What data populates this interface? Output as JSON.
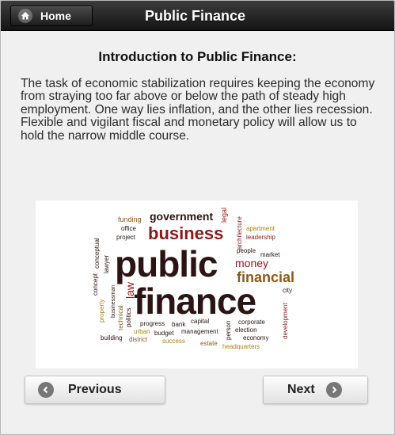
{
  "header": {
    "home_label": "Home",
    "title": "Public Finance"
  },
  "intro": {
    "heading": "Introduction to Public Finance:",
    "text": "The task of economic stabilization requires keeping the economy from straying too far above or below the path of steady high employment. One way lies inflation, and the other lies recession. Flexible and vigilant fiscal and monetary policy will allow us to hold the narrow middle course."
  },
  "word_cloud": {
    "words": {
      "funding": "funding",
      "office": "office",
      "project": "project",
      "government": "government",
      "legal": "legal",
      "architecture": "architecture",
      "apartment": "apartment",
      "leadership": "leadership",
      "business": "business",
      "conceptual": "conceptual",
      "concept": "concept",
      "lawyer": "lawyer",
      "businessman": "businessman",
      "public": "public",
      "people": "people",
      "market": "market",
      "money": "money",
      "financial": "financial",
      "city": "city",
      "law": "law",
      "finance": "finance",
      "property": "property",
      "technical": "technical",
      "politics": "politics",
      "development": "development",
      "progress": "progress",
      "bank": "bank",
      "capital": "capital",
      "person": "person",
      "corporate": "corporate",
      "election": "election",
      "economy": "economy",
      "urban": "urban",
      "budget": "budget",
      "management": "management",
      "building": "building",
      "district": "district",
      "success": "success",
      "estate": "estate",
      "headquarters": "headquarters"
    }
  },
  "nav": {
    "previous_label": "Previous",
    "next_label": "Next"
  },
  "colors": {
    "header_bg": "#1e1e1e",
    "cloud_dark": "#2a1414",
    "cloud_red": "#8b1a1a",
    "cloud_brown": "#8a5a1a",
    "cloud_gold": "#b07e12"
  }
}
